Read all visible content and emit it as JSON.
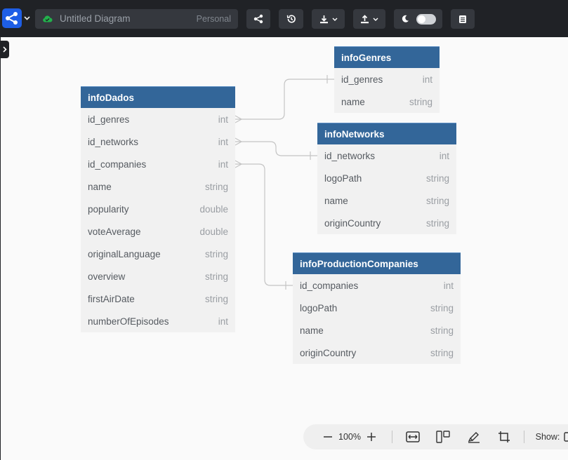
{
  "toolbar": {
    "diagram_title": "Untitled Diagram",
    "workspace": "Personal",
    "buttons": [
      "share",
      "history",
      "download",
      "upload",
      "theme-toggle",
      "notes"
    ]
  },
  "canvas": {
    "tables": [
      {
        "name": "infoDados",
        "columns": [
          {
            "name": "id_genres",
            "type": "int"
          },
          {
            "name": "id_networks",
            "type": "int"
          },
          {
            "name": "id_companies",
            "type": "int"
          },
          {
            "name": "name",
            "type": "string"
          },
          {
            "name": "popularity",
            "type": "double"
          },
          {
            "name": "voteAverage",
            "type": "double"
          },
          {
            "name": "originalLanguage",
            "type": "string"
          },
          {
            "name": "overview",
            "type": "string"
          },
          {
            "name": "firstAirDate",
            "type": "string"
          },
          {
            "name": "numberOfEpisodes",
            "type": "int"
          }
        ]
      },
      {
        "name": "infoGenres",
        "columns": [
          {
            "name": "id_genres",
            "type": "int"
          },
          {
            "name": "name",
            "type": "string"
          }
        ]
      },
      {
        "name": "infoNetworks",
        "columns": [
          {
            "name": "id_networks",
            "type": "int"
          },
          {
            "name": "logoPath",
            "type": "string"
          },
          {
            "name": "name",
            "type": "string"
          },
          {
            "name": "originCountry",
            "type": "string"
          }
        ]
      },
      {
        "name": "infoProductionCompanies",
        "columns": [
          {
            "name": "id_companies",
            "type": "int"
          },
          {
            "name": "logoPath",
            "type": "string"
          },
          {
            "name": "name",
            "type": "string"
          },
          {
            "name": "originCountry",
            "type": "string"
          }
        ]
      }
    ]
  },
  "controls": {
    "zoom": "100%",
    "show_label": "Show:"
  },
  "colors": {
    "toolbar_bg": "#202226",
    "table_header": "#336699",
    "table_body": "#f1f1f1",
    "accent": "#1e5ee6",
    "cloud_status": "#22b14c"
  }
}
